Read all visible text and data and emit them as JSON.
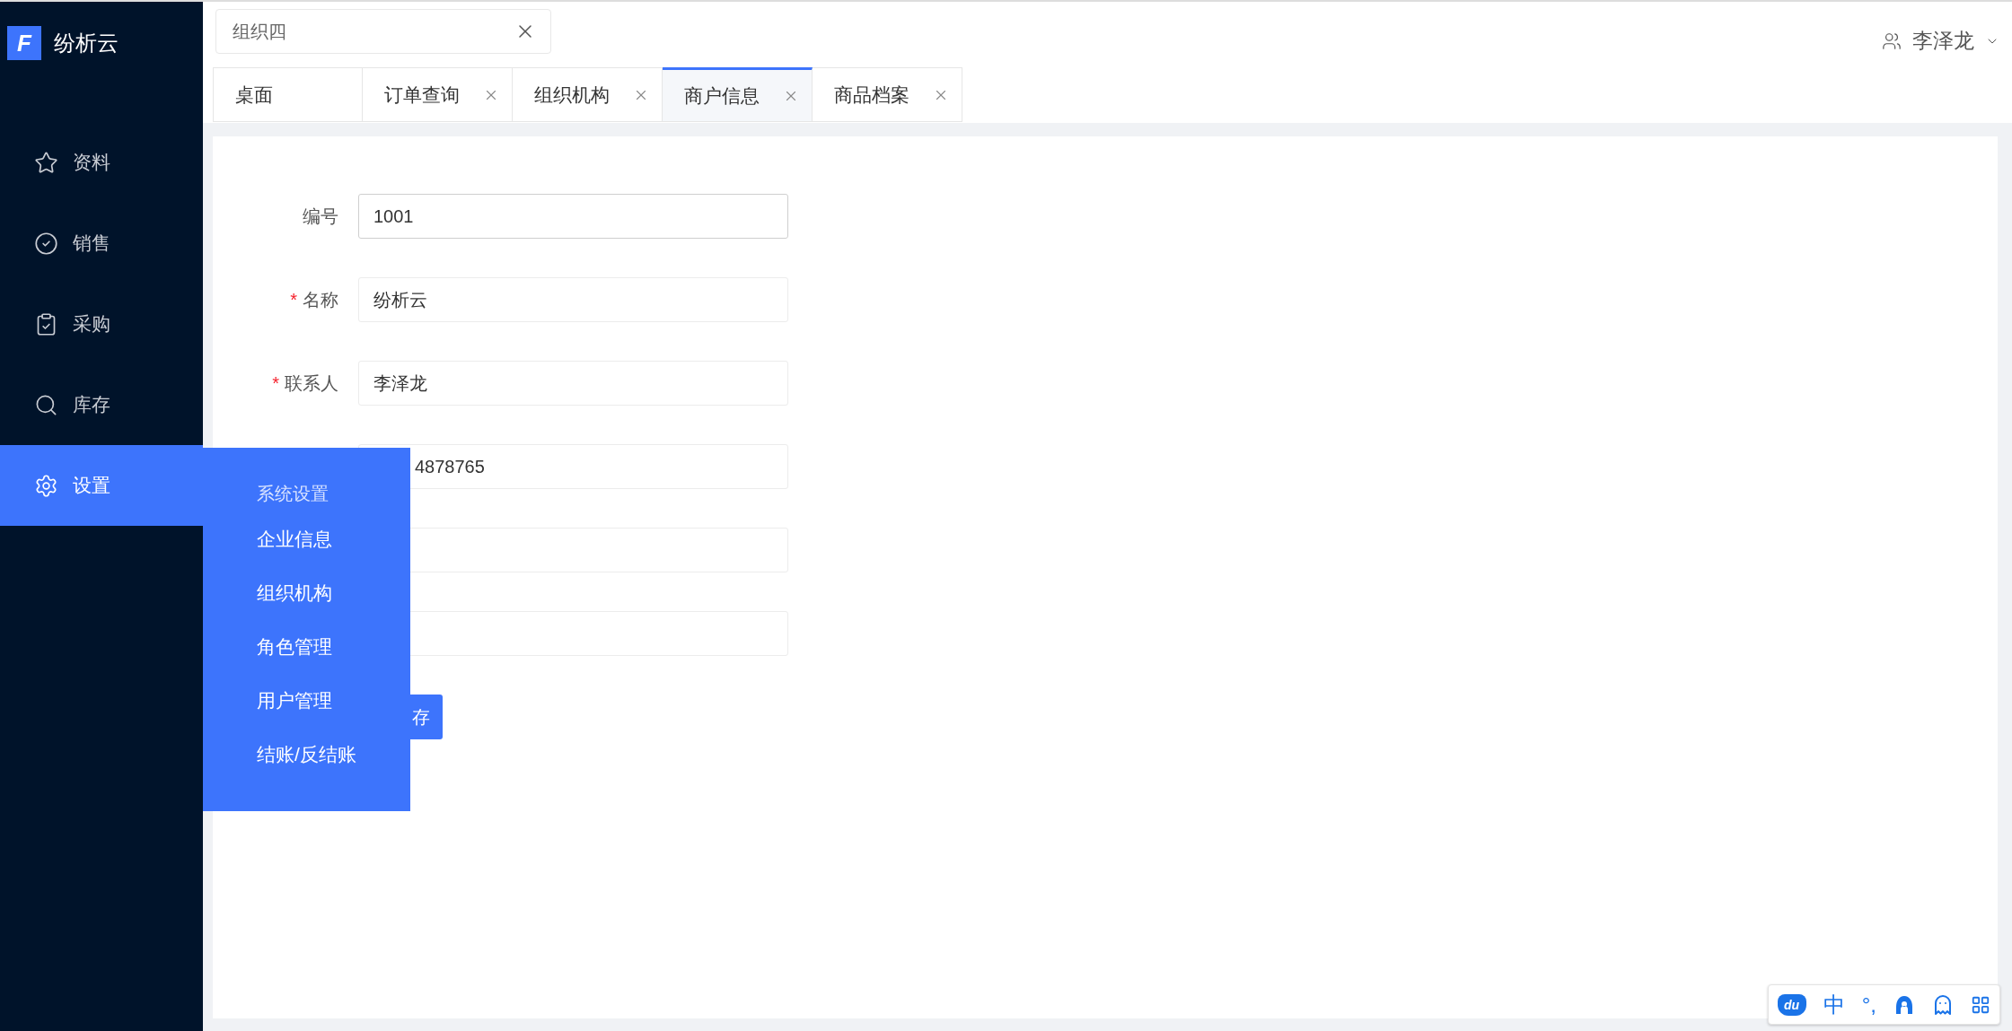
{
  "sidebar": {
    "logo": {
      "mark": "F",
      "name": "纷析云"
    },
    "items": [
      {
        "label": "资料",
        "selected": false
      },
      {
        "label": "销售",
        "selected": false
      },
      {
        "label": "采购",
        "selected": false
      },
      {
        "label": "库存",
        "selected": false
      },
      {
        "label": "设置",
        "selected": true
      }
    ]
  },
  "org_select": {
    "value": "组织四"
  },
  "user": {
    "name": "李泽龙"
  },
  "tabs": [
    {
      "label": "桌面",
      "closable": false,
      "selected": false
    },
    {
      "label": "订单查询",
      "closable": true,
      "selected": false
    },
    {
      "label": "组织机构",
      "closable": true,
      "selected": false
    },
    {
      "label": "商户信息",
      "closable": true,
      "selected": true
    },
    {
      "label": "商品档案",
      "closable": true,
      "selected": false
    }
  ],
  "form": {
    "fields": [
      {
        "label": "编号",
        "value": "1001",
        "focused": true
      },
      {
        "label": "名称",
        "required_mark": "*",
        "value": "纷析云",
        "focused": false
      },
      {
        "label": "联系人",
        "required_mark": "*",
        "value": "李泽龙",
        "focused": false
      },
      {
        "value": "4878765",
        "focused": false
      },
      {
        "focused": false
      },
      {
        "focused": false
      }
    ],
    "save_button": {
      "label": "存"
    }
  },
  "flyout": {
    "title": "系统设置",
    "items": [
      "企业信息",
      "组织机构",
      "角色管理",
      "用户管理",
      "结账/反结账"
    ]
  },
  "ime_toolbar": {
    "logo": "du",
    "mode": "中",
    "punctuation": "°,"
  }
}
